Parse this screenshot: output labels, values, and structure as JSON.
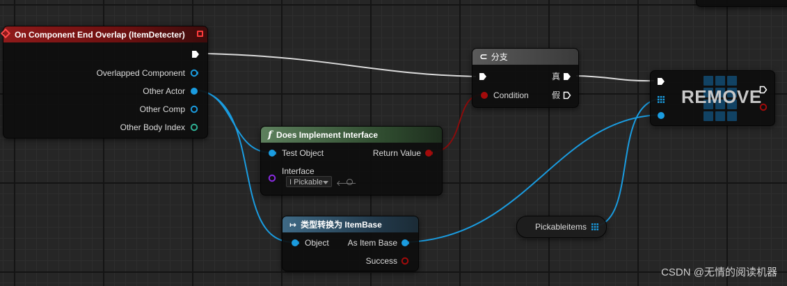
{
  "colors": {
    "exec": "#ffffff",
    "object": "#1a9ce0",
    "bool": "#a30b0b",
    "struct": "#2fb094",
    "interface": "#8a2be2",
    "event_header": "#7a1212",
    "function_header": "#3f5f3f",
    "cast_header": "#2b4a5e",
    "branch_header": "#444444"
  },
  "event_node": {
    "title": "On Component End Overlap (ItemDetecter)",
    "icon": "event-diamond-icon",
    "pins": [
      "Overlapped Component",
      "Other Actor",
      "Other Comp",
      "Other Body Index"
    ]
  },
  "branch_node": {
    "title": "分支",
    "icon": "branch-icon",
    "condition": "Condition",
    "true_label": "真",
    "false_label": "假"
  },
  "interface_node": {
    "title": "Does Implement Interface",
    "icon": "function-icon",
    "test_object": "Test Object",
    "return_value": "Return Value",
    "interface_label": "Interface",
    "interface_value": "I Pickable"
  },
  "cast_node": {
    "title": "类型转换为 ItemBase",
    "icon": "cast-arrow-icon",
    "object": "Object",
    "as_item": "As Item Base",
    "success": "Success"
  },
  "remove_node": {
    "title": "REMOVE",
    "icon": "array-grid-icon"
  },
  "variable_node": {
    "label": "Pickableitems",
    "icon": "array-grid-icon"
  },
  "watermark": "CSDN @无情的阅读机器"
}
